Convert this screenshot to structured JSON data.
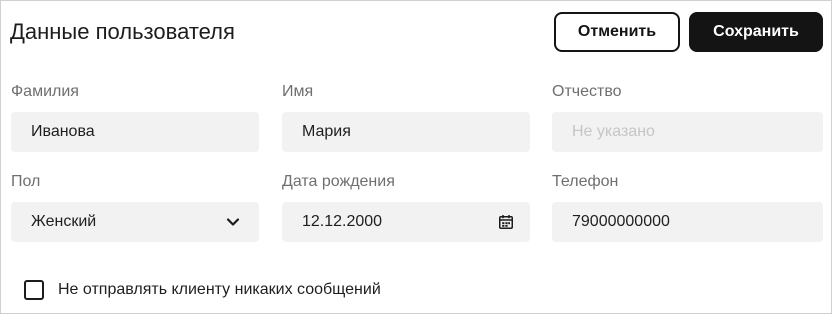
{
  "header": {
    "title": "Данные пользователя",
    "cancel_label": "Отменить",
    "save_label": "Сохранить"
  },
  "form": {
    "last_name": {
      "label": "Фамилия",
      "value": "Иванова"
    },
    "first_name": {
      "label": "Имя",
      "value": "Мария"
    },
    "patronymic": {
      "label": "Отчество",
      "placeholder": "Не указано"
    },
    "gender": {
      "label": "Пол",
      "value": "Женский",
      "icon": "chevron-down-icon"
    },
    "birth_date": {
      "label": "Дата рождения",
      "value": "12.12.2000",
      "icon": "calendar-icon"
    },
    "phone": {
      "label": "Телефон",
      "value": "79000000000"
    }
  },
  "options": {
    "no_messages_label": "Не отправлять клиенту никаких сообщений",
    "no_messages_checked": false
  },
  "colors": {
    "primary": "#141414",
    "field_background": "#f2f2f2",
    "label_text": "#6f6f6f",
    "placeholder_text": "#c6c6c6"
  }
}
